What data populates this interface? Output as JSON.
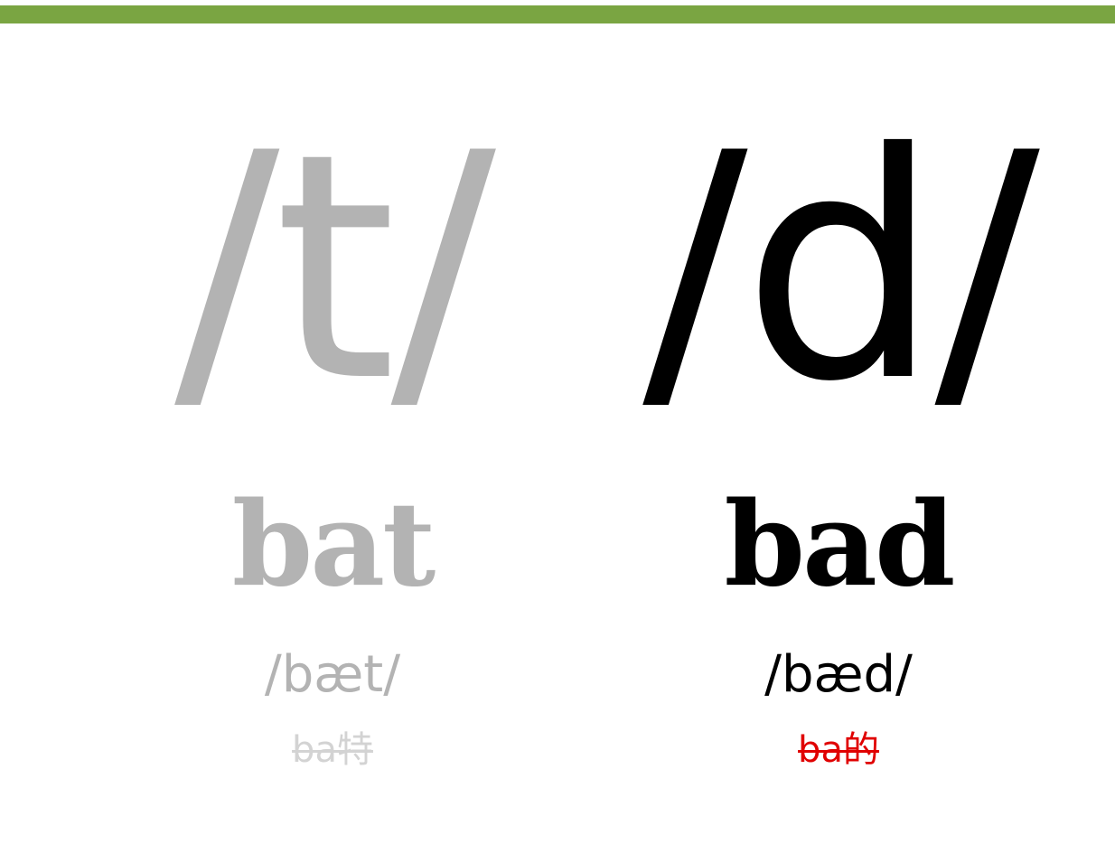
{
  "accent_bar_color": "#7aa542",
  "left": {
    "phoneme": "/t/",
    "word": "bat",
    "ipa": "/bæt/",
    "mispronunciation": "ba特",
    "text_color": "#b3b3b3",
    "mispronunciation_color": "#d3d3d3"
  },
  "right": {
    "phoneme": "/d/",
    "word": "bad",
    "ipa": "/bæd/",
    "mispronunciation": "ba的",
    "text_color": "#000000",
    "mispronunciation_color": "#e00000"
  }
}
